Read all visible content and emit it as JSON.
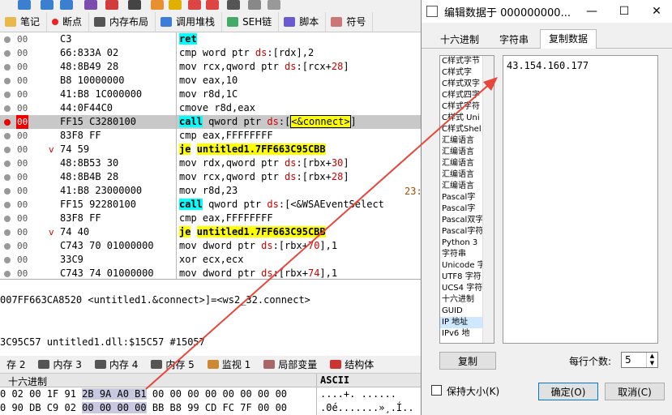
{
  "main_tabs": [
    {
      "label": "笔记",
      "icon": "notes-icon"
    },
    {
      "label": "断点",
      "icon": "breakpoint-icon"
    },
    {
      "label": "内存布局",
      "icon": "memory-map-icon"
    },
    {
      "label": "调用堆栈",
      "icon": "call-stack-icon"
    },
    {
      "label": "SEH链",
      "icon": "seh-icon"
    },
    {
      "label": "脚本",
      "icon": "script-icon"
    },
    {
      "label": "符号",
      "icon": "symbol-icon"
    }
  ],
  "disasm_rows": [
    {
      "bp": "00",
      "arrow": "",
      "bytes": "C3",
      "instr": "ret"
    },
    {
      "bp": "00",
      "arrow": "",
      "bytes": "66:833A 02",
      "instr": "cmp word ptr ds:[rdx],2"
    },
    {
      "bp": "00",
      "arrow": "",
      "bytes": "48:8B49 28",
      "instr": "mov rcx,qword ptr ds:[rcx+28]"
    },
    {
      "bp": "00",
      "arrow": "",
      "bytes": "B8 10000000",
      "instr": "mov eax,10"
    },
    {
      "bp": "00",
      "arrow": "",
      "bytes": "41:B8 1C000000",
      "instr": "mov r8d,1C"
    },
    {
      "bp": "00",
      "arrow": "",
      "bytes": "44:0F44C0",
      "instr": "cmove r8d,eax"
    },
    {
      "bp": "00",
      "arrow": "",
      "bytes": "FF15 C3280100",
      "instr": "call qword ptr ds:[<&connect>]"
    },
    {
      "bp": "00",
      "arrow": "",
      "bytes": "83F8 FF",
      "instr": "cmp eax,FFFFFFFF"
    },
    {
      "bp": "00",
      "arrow": "v",
      "bytes": "74 59",
      "instr": "je untitled1.7FF663C95CBB"
    },
    {
      "bp": "00",
      "arrow": "",
      "bytes": "48:8B53 30",
      "instr": "mov rdx,qword ptr ds:[rbx+30]"
    },
    {
      "bp": "00",
      "arrow": "",
      "bytes": "48:8B4B 28",
      "instr": "mov rcx,qword ptr ds:[rbx+28]"
    },
    {
      "bp": "00",
      "arrow": "",
      "bytes": "41:B8 23000000",
      "instr": "mov r8d,23"
    },
    {
      "bp": "00",
      "arrow": "",
      "bytes": "FF15 92280100",
      "instr": "call qword ptr ds:[<&WSAEventSelect"
    },
    {
      "bp": "00",
      "arrow": "",
      "bytes": "83F8 FF",
      "instr": "cmp eax,FFFFFFFF"
    },
    {
      "bp": "00",
      "arrow": "v",
      "bytes": "74 40",
      "instr": "je untitled1.7FF663C95CBB"
    },
    {
      "bp": "00",
      "arrow": "",
      "bytes": "C743 70 01000000",
      "instr": "mov dword ptr ds:[rbx+70],1"
    },
    {
      "bp": "00",
      "arrow": "",
      "bytes": "33C9",
      "instr": "xor ecx,ecx"
    },
    {
      "bp": "00",
      "arrow": "",
      "bytes": "C743 74 01000000",
      "instr": "mov dword ptr ds:[rbx+74],1"
    }
  ],
  "comment_right": "23:",
  "info_line1": "007FF663CA8520 <untitled1.&connect>]=<ws2_32.connect>",
  "info_line2": "3C95C57 untitled1.dll:$15C57 #15057",
  "dump_tabs": [
    {
      "label": "存 2",
      "icon": ""
    },
    {
      "label": "内存 3",
      "icon": "memory-icon"
    },
    {
      "label": "内存 4",
      "icon": "memory-icon"
    },
    {
      "label": "内存 5",
      "icon": "memory-icon"
    },
    {
      "label": "监视 1",
      "icon": "watch-icon"
    },
    {
      "label": "局部变量",
      "icon": "locals-icon"
    },
    {
      "label": "结构体",
      "icon": "struct-icon"
    }
  ],
  "hex_header_hex": "十六进制",
  "hex_header_ascii": "ASCII",
  "hex_rows": [
    {
      "pre": "0 02 00 1F 91 ",
      "hl": "2B 9A A0 B1",
      "post": " 00 00 00 00 00 00 00 00",
      "ascii": "....+. ......"
    },
    {
      "pre": "0 90 DB C9 02 ",
      "hl": "00 00 00 00",
      "post": " BB B8 99 CD FC 7F 00 00",
      "ascii": ".0é.......»¸.Í.."
    }
  ],
  "dialog": {
    "title": "编辑数据于 000000000...",
    "tabs": [
      "十六进制",
      "字符串",
      "复制数据"
    ],
    "active_tab": 2,
    "formats": [
      "C样式字节",
      "C样式字",
      "C样式双字",
      "C样式四字",
      "C样式字符",
      "C样式 Uni",
      "C样式Shel",
      "汇编语言",
      "汇编语言",
      "汇编语言",
      "汇编语言",
      "汇编语言",
      "Pascal字",
      "Pascal字",
      "Pascal双字",
      "Pascal字符",
      "Python 3",
      "字符串",
      "Unicode 字",
      "UTF8 字符",
      "UCS4 字符",
      "十六进制",
      "GUID",
      "IP 地址",
      "IPv6 地"
    ],
    "selected_format": 23,
    "output": "43.154.160.177",
    "copy_label": "复制",
    "per_row_label": "每行个数:",
    "per_row_value": "5",
    "keep_size_label": "保持大小(K)",
    "ok_label": "确定(O)",
    "cancel_label": "取消(C)"
  },
  "colors": {
    "highlight_cyan": "#00ffff",
    "highlight_yellow": "#ffff00",
    "breakpoint_red": "#e00000",
    "annotation_arrow": "#e8463a"
  }
}
